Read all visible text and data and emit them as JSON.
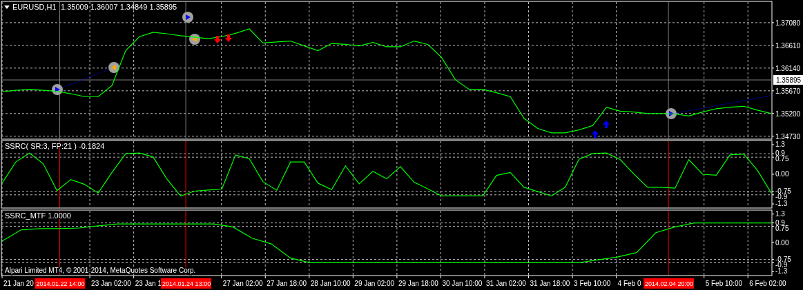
{
  "chart_window": {
    "symbol": "EURUSD,H1",
    "quotes": [
      "1.35009",
      "1.36007",
      "1.34849",
      "1.35895"
    ],
    "copyright": "Alpari Limited MT4, © 2001-2014, MetaQuotes Software Corp."
  },
  "price_chart": {
    "chart_data": {
      "type": "line",
      "grid": true,
      "ylim": [
        1.3467,
        1.3752
      ],
      "categories": [
        null,
        null,
        null,
        null,
        null,
        null,
        null,
        null,
        null,
        null,
        null,
        null,
        null,
        null,
        null,
        null,
        null,
        null,
        null,
        null,
        null,
        null,
        null,
        null,
        null,
        null,
        null,
        null,
        null,
        null,
        null,
        null,
        null,
        null,
        null,
        null,
        null,
        null,
        null,
        null,
        null,
        null,
        null,
        null,
        null,
        null,
        null,
        null,
        null,
        null,
        null,
        null,
        null,
        null,
        null,
        null,
        null
      ],
      "series": [
        {
          "color": "#00ff00",
          "values": [
            1.3565,
            1.3568,
            1.357,
            1.3568,
            1.3566,
            1.3561,
            1.3555,
            1.3555,
            1.3578,
            1.365,
            1.3679,
            1.3688,
            1.3685,
            1.3681,
            1.3678,
            1.3675,
            1.3679,
            1.3686,
            1.3695,
            1.3666,
            1.3668,
            1.367,
            1.366,
            1.365,
            1.3665,
            1.3663,
            1.366,
            1.3667,
            1.3658,
            1.3658,
            1.367,
            1.3663,
            1.3636,
            1.359,
            1.357,
            1.357,
            1.3563,
            1.3555,
            1.351,
            1.3489,
            1.348,
            1.348,
            1.3486,
            1.3495,
            1.3533,
            1.3525,
            1.3523,
            1.352,
            1.352,
            1.3519,
            1.3515,
            1.3523,
            1.353,
            1.3533,
            1.3535,
            1.3527,
            1.352
          ]
        }
      ],
      "yticks": [
        {
          "value": 1.3708,
          "label": "1.37080"
        },
        {
          "value": 1.3661,
          "label": "1.36610"
        },
        {
          "value": 1.3614,
          "label": "1.36140"
        },
        {
          "value": 1.3567,
          "label": "1.35670"
        },
        {
          "value": 1.352,
          "label": "1.35200"
        },
        {
          "value": 1.3473,
          "label": "1.34730"
        }
      ],
      "annotations": [
        {
          "y": 1.35895,
          "text": "1.35895"
        }
      ]
    }
  },
  "ssrc_indicator": {
    "label": "SSRC( SR:3, FP:21 ) -0.1824",
    "chart_data": {
      "type": "line",
      "grid": true,
      "ylim": [
        -1.48,
        1.48
      ],
      "categories": [
        null,
        null,
        null,
        null,
        null,
        null,
        null,
        null,
        null,
        null,
        null,
        null,
        null,
        null,
        null,
        null,
        null,
        null,
        null,
        null,
        null,
        null,
        null,
        null,
        null,
        null,
        null,
        null,
        null,
        null,
        null,
        null,
        null,
        null,
        null,
        null,
        null,
        null,
        null,
        null,
        null,
        null,
        null,
        null,
        null,
        null,
        null,
        null,
        null,
        null,
        null,
        null,
        null,
        null,
        null,
        null,
        null
      ],
      "series": [
        {
          "color": "#00ff00",
          "values": [
            -0.39,
            0.54,
            0.93,
            0.46,
            -0.72,
            -0.23,
            -0.44,
            -0.82,
            0.08,
            0.9,
            0.93,
            0.76,
            -0.21,
            -0.95,
            -0.74,
            -0.69,
            -0.65,
            0.85,
            0.68,
            -0.33,
            -0.7,
            0.54,
            0.54,
            -0.39,
            -0.67,
            0.37,
            -0.42,
            0.13,
            -0.2,
            0.34,
            -0.35,
            -0.64,
            -0.95,
            -0.95,
            -0.95,
            -0.95,
            -0.05,
            0.08,
            -0.57,
            -0.76,
            -0.95,
            -0.57,
            0.66,
            0.91,
            0.93,
            0.65,
            0.01,
            -0.57,
            -0.57,
            -0.61,
            0.64,
            0.0,
            -0.04,
            0.85,
            0.89,
            0.17,
            -0.82
          ]
        }
      ],
      "yticks": [
        {
          "value": 1.3,
          "label": "1.3"
        },
        {
          "value": 0.9,
          "label": "0.9"
        },
        {
          "value": 0.75,
          "label": "0.75"
        },
        {
          "value": 0,
          "label": "0.00"
        },
        {
          "value": -0.75,
          "label": "-0.75"
        },
        {
          "value": -0.9,
          "label": "-0.9"
        },
        {
          "value": -1.3,
          "label": "-1.3"
        }
      ]
    }
  },
  "mtf_indicator": {
    "label": "SSRC_MTF 1.0000",
    "chart_data": {
      "type": "line",
      "grid": true,
      "ylim": [
        -1.48,
        1.48
      ],
      "categories": [
        null,
        null,
        null,
        null,
        null,
        null,
        null,
        null,
        null,
        null,
        null,
        null,
        null,
        null,
        null,
        null,
        null,
        null,
        null,
        null,
        null,
        null,
        null,
        null,
        null,
        null,
        null,
        null,
        null,
        null,
        null,
        null,
        null,
        null,
        null,
        null,
        null,
        null,
        null,
        null,
        null
      ],
      "series": [
        {
          "color": "#00ff00",
          "values": [
            0.08,
            0.59,
            0.64,
            0.64,
            0.67,
            0.77,
            0.85,
            0.85,
            0.85,
            0.85,
            0.85,
            0.85,
            0.72,
            0.21,
            -0.05,
            -0.69,
            -0.9,
            -0.9,
            -0.9,
            -0.9,
            -0.9,
            -0.9,
            -0.9,
            -0.9,
            -0.9,
            -0.9,
            -0.9,
            -0.9,
            -0.9,
            -0.9,
            -0.9,
            -0.77,
            -0.64,
            -0.44,
            0.46,
            0.72,
            0.9,
            0.9,
            0.9,
            0.9,
            0.9
          ]
        }
      ],
      "yticks": [
        {
          "value": 1.3,
          "label": "1.3"
        },
        {
          "value": 0.9,
          "label": "0.9"
        },
        {
          "value": 0.75,
          "label": "0.75"
        },
        {
          "value": 0,
          "label": "0.00"
        },
        {
          "value": -0.75,
          "label": "-0.75"
        },
        {
          "value": -0.9,
          "label": "-0.9"
        },
        {
          "value": -1.3,
          "label": "-1.3"
        }
      ]
    }
  },
  "time_axis": {
    "labels": [
      "21 Jan 20",
      "23 Jan 02:00",
      "23 Jan 1",
      "27 Jan 02:00",
      "27 Jan 18:00",
      "28 Jan 10:00",
      "29 Jan 02:00",
      "29 Jan 18:00",
      "30 Jan 10:00",
      "31 Jan 02:00",
      "31 Jan 18:00",
      "3 Feb 10:00",
      "4 Feb 0",
      "5 Feb 10:00",
      "6 Feb 02:00"
    ],
    "markers": [
      "2014.01.22 14:00",
      "2014.01.24 13:00",
      "2014.02.04 20:00"
    ]
  }
}
